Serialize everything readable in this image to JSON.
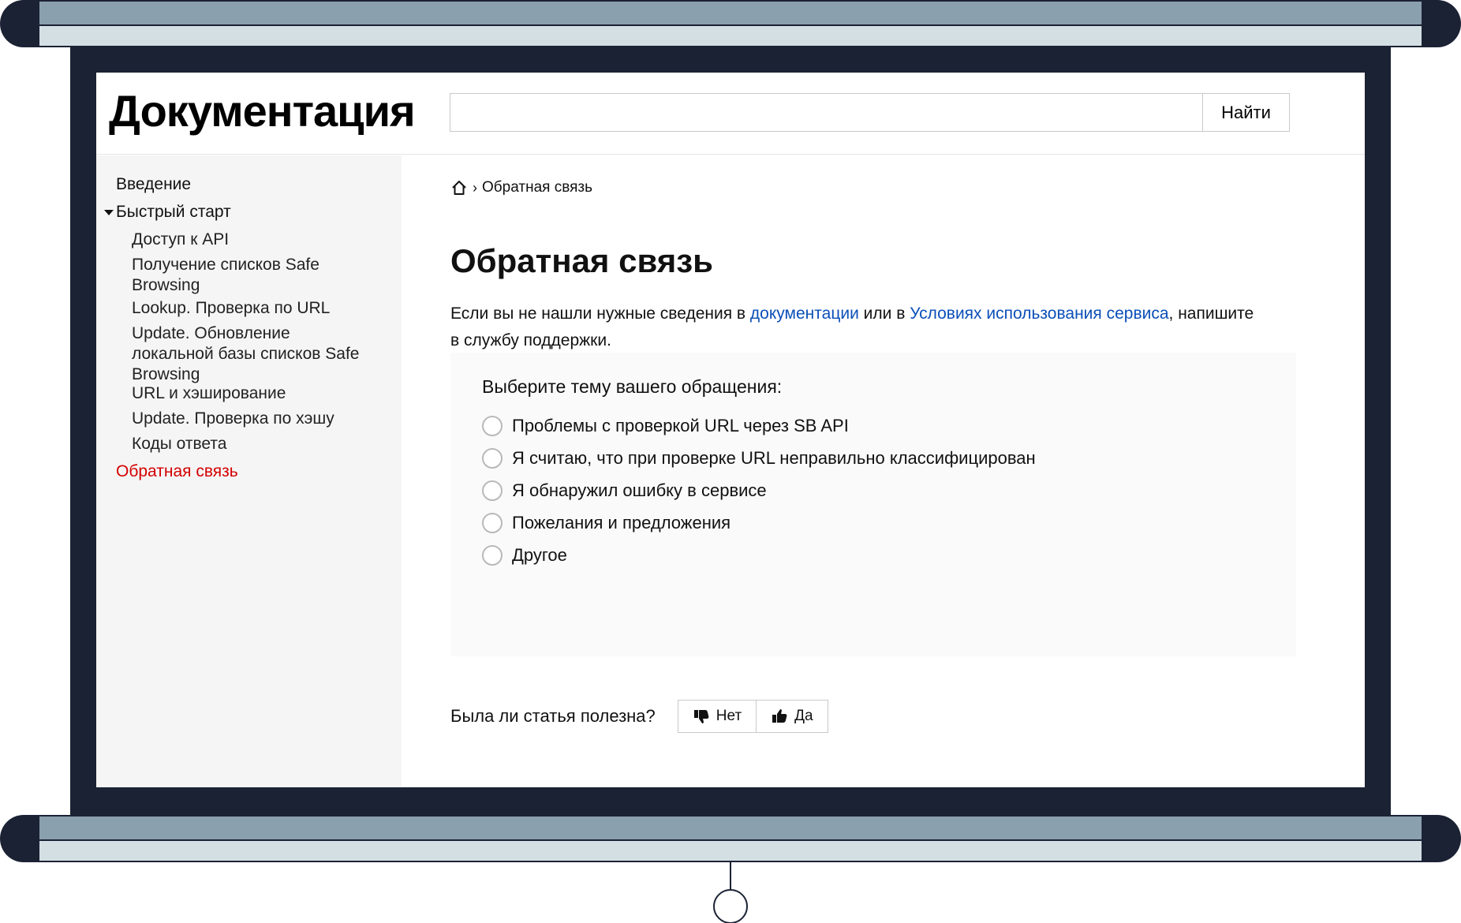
{
  "header": {
    "logo": "Документация",
    "search_placeholder": "",
    "search_button": "Найти"
  },
  "sidebar": {
    "items": [
      {
        "label": "Введение"
      },
      {
        "label": "Быстрый старт"
      },
      {
        "label": "Доступ к API"
      },
      {
        "label": "Получение списков Safe Browsing"
      },
      {
        "label": "Lookup. Проверка по URL"
      },
      {
        "label": "Update. Обновление локальной базы списков Safe Browsing"
      },
      {
        "label": "URL и хэширование"
      },
      {
        "label": "Update. Проверка по хэшу"
      },
      {
        "label": "Коды ответа"
      },
      {
        "label": "Обратная связь"
      }
    ]
  },
  "main": {
    "breadcrumb": "Обратная связь",
    "title": "Обратная связь",
    "intro_before": "Если вы не нашли нужные сведения в ",
    "intro_link1": "документации",
    "intro_middle": " или в ",
    "intro_link2": "Условиях использования сервиса",
    "intro_after": ", напишите в службу поддержки.",
    "form_question": "Выберите тему вашего обращения:",
    "options": [
      "Проблемы с проверкой URL через SB API",
      "Я считаю, что при проверке URL неправильно классифицирован",
      "Я обнаружил ошибку в сервисе",
      "Пожелания и предложения",
      "Другое"
    ],
    "feedback_question": "Была ли статья полезна?",
    "no_label": "Нет",
    "yes_label": "Да"
  },
  "colors": {
    "frame": "#1b2234",
    "roller": "#8aa0ae",
    "link": "#0b4fb8",
    "active": "#d40000",
    "sidebar_bg": "#f5f5f5"
  }
}
